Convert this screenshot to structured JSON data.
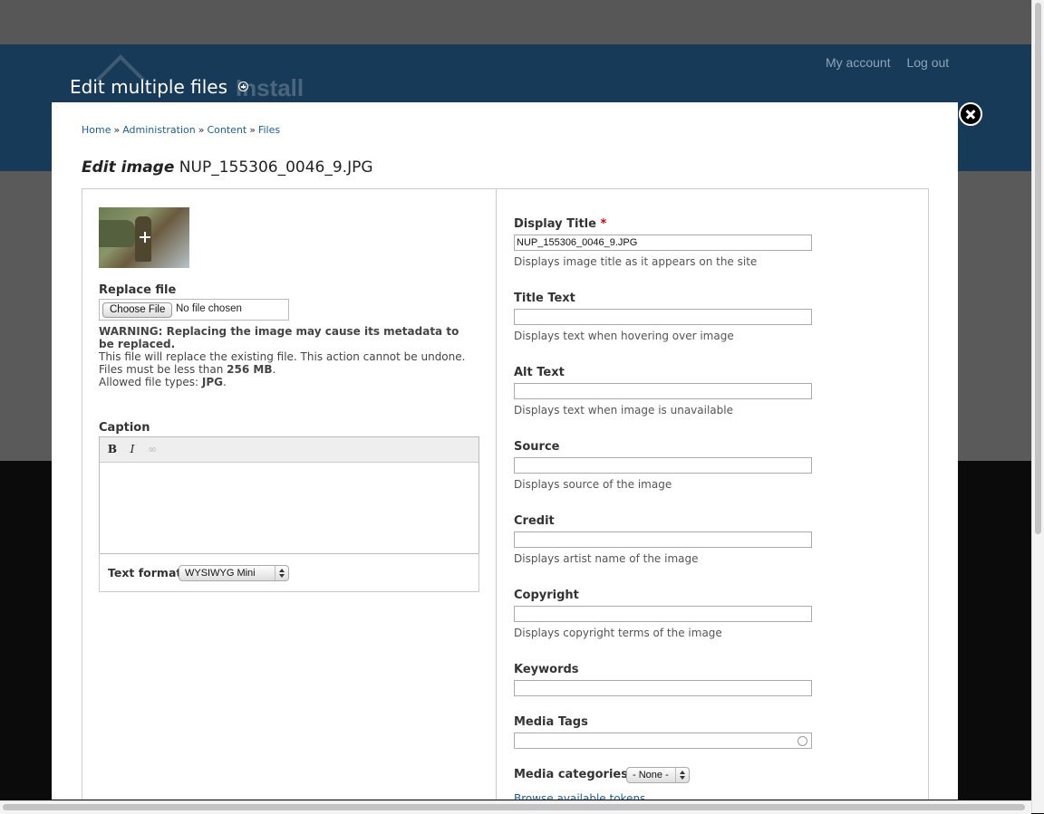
{
  "header": {
    "links": [
      "My account",
      "Log out"
    ],
    "logo_text": "Install",
    "overlay_title": "Edit multiple files"
  },
  "breadcrumb": [
    "Home",
    "Administration",
    "Content",
    "Files"
  ],
  "breadcrumb_separator": "»",
  "page_title": {
    "prefix": "Edit image",
    "filename": "NUP_155306_0046_9.JPG"
  },
  "left": {
    "replace_file": {
      "label": "Replace file",
      "button": "Choose File",
      "status": "No file chosen"
    },
    "warning": {
      "line1": "WARNING: Replacing the image may cause its metadata to be replaced.",
      "line2": "This file will replace the existing file. This action cannot be undone.",
      "size_prefix": "Files must be less than ",
      "size_value": "256 MB",
      "types_prefix": "Allowed file types: ",
      "types_value": "JPG"
    },
    "caption": {
      "label": "Caption",
      "toolbar": {
        "bold": "B",
        "italic": "I",
        "link": "∞"
      }
    },
    "text_format": {
      "label": "Text format",
      "selected": "WYSIWYG Mini"
    }
  },
  "right": {
    "fields": [
      {
        "label": "Display Title",
        "required": "*",
        "value": "NUP_155306_0046_9.JPG",
        "description": "Displays image title as it appears on the site"
      },
      {
        "label": "Title Text",
        "value": "",
        "description": "Displays text when hovering over image"
      },
      {
        "label": "Alt Text",
        "value": "",
        "description": "Displays text when image is unavailable"
      },
      {
        "label": "Source",
        "value": "",
        "description": "Displays source of the image"
      },
      {
        "label": "Credit",
        "value": "",
        "description": "Displays artist name of the image"
      },
      {
        "label": "Copyright",
        "value": "",
        "description": "Displays copyright terms of the image"
      },
      {
        "label": "Keywords",
        "value": ""
      },
      {
        "label": "Media Tags",
        "value": ""
      }
    ],
    "media_categories": {
      "label": "Media categories",
      "selected": "- None -"
    },
    "tokens_link": "Browse available tokens."
  },
  "colors": {
    "header_bg": "#163a57",
    "link": "#1f5e8e",
    "required": "#cc0000"
  }
}
